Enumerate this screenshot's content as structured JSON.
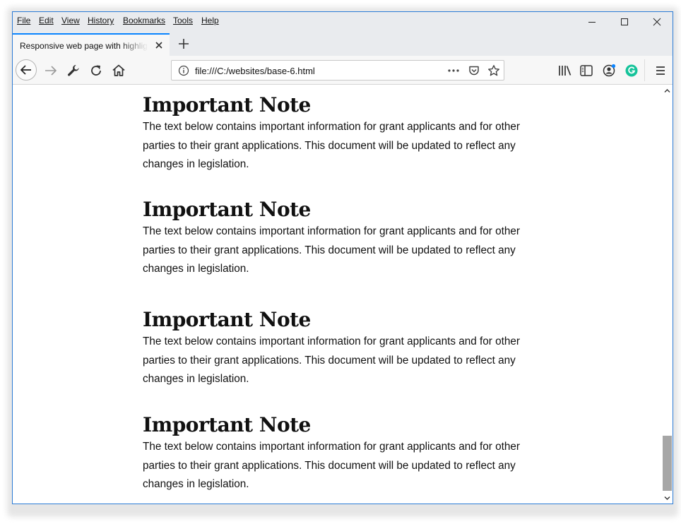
{
  "menubar": {
    "items": [
      {
        "label": "File"
      },
      {
        "label": "Edit"
      },
      {
        "label": "View"
      },
      {
        "label": "History"
      },
      {
        "label": "Bookmarks"
      },
      {
        "label": "Tools"
      },
      {
        "label": "Help"
      }
    ]
  },
  "window_controls": [
    "minimize-icon",
    "maximize-icon",
    "close-icon"
  ],
  "tab": {
    "title": "Responsive web page with highlights"
  },
  "navbar": {
    "url": "file:///C:/websites/base-6.html",
    "icons": [
      "back-icon",
      "forward-icon",
      "wrench-icon",
      "reload-icon",
      "home-icon",
      "info-icon",
      "more-icon",
      "pocket-icon",
      "star-icon",
      "library-icon",
      "sidebar-icon",
      "account-icon",
      "grammarly-icon",
      "menu-icon"
    ],
    "accent_color": "#0a84ff",
    "grammarly_color": "#15c39a"
  },
  "content": {
    "notes": [
      {
        "heading": "Important Note",
        "body": "The text below contains important information for grant applicants and for other parties to their grant applications. This document will be updated to reflect any changes in legislation."
      },
      {
        "heading": "Important Note",
        "body": "The text below contains important information for grant applicants and for other parties to their grant applications. This document will be updated to reflect any changes in legislation."
      },
      {
        "heading": "Important Note",
        "body": "The text below contains important information for grant applicants and for other parties to their grant applications. This document will be updated to reflect any changes in legislation."
      },
      {
        "heading": "Important Note",
        "body": "The text below contains important information for grant applicants and for other parties to their grant applications. This document will be updated to reflect any changes in legislation."
      }
    ]
  },
  "scrollbar": {
    "position": 1.0
  }
}
